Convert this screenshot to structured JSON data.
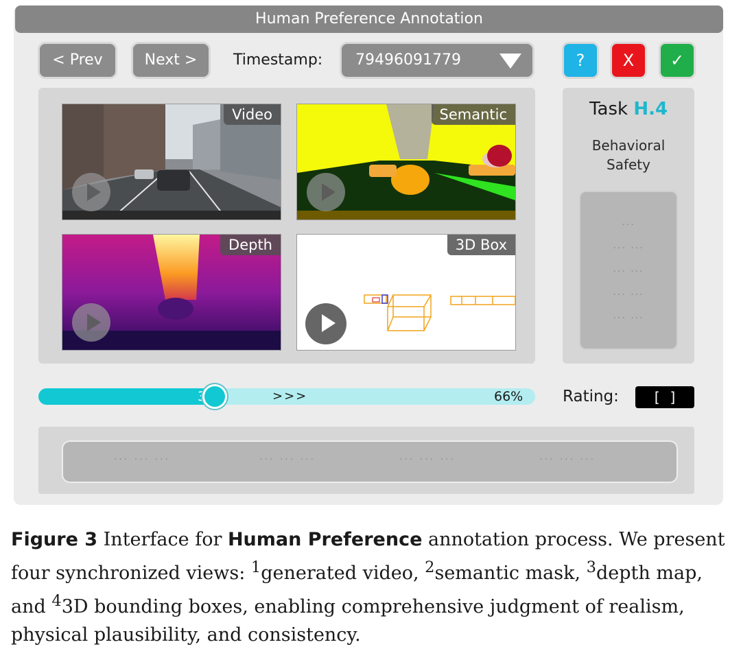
{
  "window": {
    "title": "Human Preference Annotation"
  },
  "toolbar": {
    "prev_label": "< Prev",
    "next_label": "Next >",
    "timestamp_label": "Timestamp:",
    "timestamp_value": "79496091779",
    "help_label": "?",
    "close_label": "X",
    "ok_label": "✓"
  },
  "views": [
    {
      "label": "Video"
    },
    {
      "label": "Semantic"
    },
    {
      "label": "Depth"
    },
    {
      "label": "3D Box"
    }
  ],
  "task": {
    "title": "Task",
    "id": "H.4",
    "name_line1": "Behavioral",
    "name_line2": "Safety"
  },
  "progress": {
    "left_label": "34%",
    "right_label": "66%",
    "arrows": ">>>",
    "value_fraction": 0.34
  },
  "rating": {
    "label": "Rating:",
    "value": "[  ]"
  },
  "caption": {
    "fig_label": "Figure 3",
    "text_1": " Interface for ",
    "bold": "Human Preference",
    "text_2": " annotation process. We present four synchronized views: ",
    "sup1": "1",
    "item1": "generated video, ",
    "sup2": "2",
    "item2": "semantic mask, ",
    "sup3": "3",
    "item3": "depth map, and ",
    "sup4": "4",
    "item4": "3D bounding boxes, enabling comprehensive judgment of realism, physical plausibility, and consistency."
  },
  "colors": {
    "accent": "#11c8d3",
    "help": "#1fb3e6",
    "close": "#e8161c",
    "ok": "#1fae49",
    "task_id": "#1fb7cc"
  }
}
